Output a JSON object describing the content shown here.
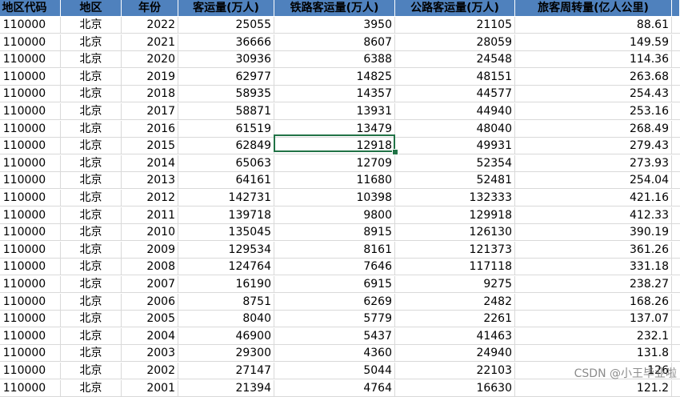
{
  "headers": [
    "地区代码",
    "地区",
    "年份",
    "客运量(万人)",
    "铁路客运量(万人)",
    "公路客运量(万人)",
    "旅客周转量(亿人公里)"
  ],
  "rows": [
    [
      "110000",
      "北京",
      "2022",
      "25055",
      "3950",
      "21105",
      "88.61"
    ],
    [
      "110000",
      "北京",
      "2021",
      "36666",
      "8607",
      "28059",
      "149.59"
    ],
    [
      "110000",
      "北京",
      "2020",
      "30936",
      "6388",
      "24548",
      "114.36"
    ],
    [
      "110000",
      "北京",
      "2019",
      "62977",
      "14825",
      "48151",
      "263.68"
    ],
    [
      "110000",
      "北京",
      "2018",
      "58935",
      "14357",
      "44577",
      "254.43"
    ],
    [
      "110000",
      "北京",
      "2017",
      "58871",
      "13931",
      "44940",
      "253.16"
    ],
    [
      "110000",
      "北京",
      "2016",
      "61519",
      "13479",
      "48040",
      "268.49"
    ],
    [
      "110000",
      "北京",
      "2015",
      "62849",
      "12918",
      "49931",
      "279.43"
    ],
    [
      "110000",
      "北京",
      "2014",
      "65063",
      "12709",
      "52354",
      "273.93"
    ],
    [
      "110000",
      "北京",
      "2013",
      "64161",
      "11680",
      "52481",
      "254.04"
    ],
    [
      "110000",
      "北京",
      "2012",
      "142731",
      "10398",
      "132333",
      "421.16"
    ],
    [
      "110000",
      "北京",
      "2011",
      "139718",
      "9800",
      "129918",
      "412.33"
    ],
    [
      "110000",
      "北京",
      "2010",
      "135045",
      "8915",
      "126130",
      "390.19"
    ],
    [
      "110000",
      "北京",
      "2009",
      "129534",
      "8161",
      "121373",
      "361.26"
    ],
    [
      "110000",
      "北京",
      "2008",
      "124764",
      "7646",
      "117118",
      "331.18"
    ],
    [
      "110000",
      "北京",
      "2007",
      "16190",
      "6915",
      "9275",
      "238.27"
    ],
    [
      "110000",
      "北京",
      "2006",
      "8751",
      "6269",
      "2482",
      "168.26"
    ],
    [
      "110000",
      "北京",
      "2005",
      "8040",
      "5779",
      "2261",
      "137.07"
    ],
    [
      "110000",
      "北京",
      "2004",
      "46900",
      "5437",
      "41463",
      "232.1"
    ],
    [
      "110000",
      "北京",
      "2003",
      "29300",
      "4360",
      "24940",
      "131.8"
    ],
    [
      "110000",
      "北京",
      "2002",
      "27147",
      "5044",
      "22103",
      "126"
    ],
    [
      "110000",
      "北京",
      "2001",
      "21394",
      "4764",
      "16630",
      "121.2"
    ]
  ],
  "selected_cell": {
    "row_index": 7,
    "column": "铁路客运量(万人)",
    "value": "12918"
  },
  "watermark": "CSDN @小王毕业啦",
  "colors": {
    "header_bg": "#4f81bd",
    "selection": "#217346",
    "gridline": "#d9d9d9"
  }
}
